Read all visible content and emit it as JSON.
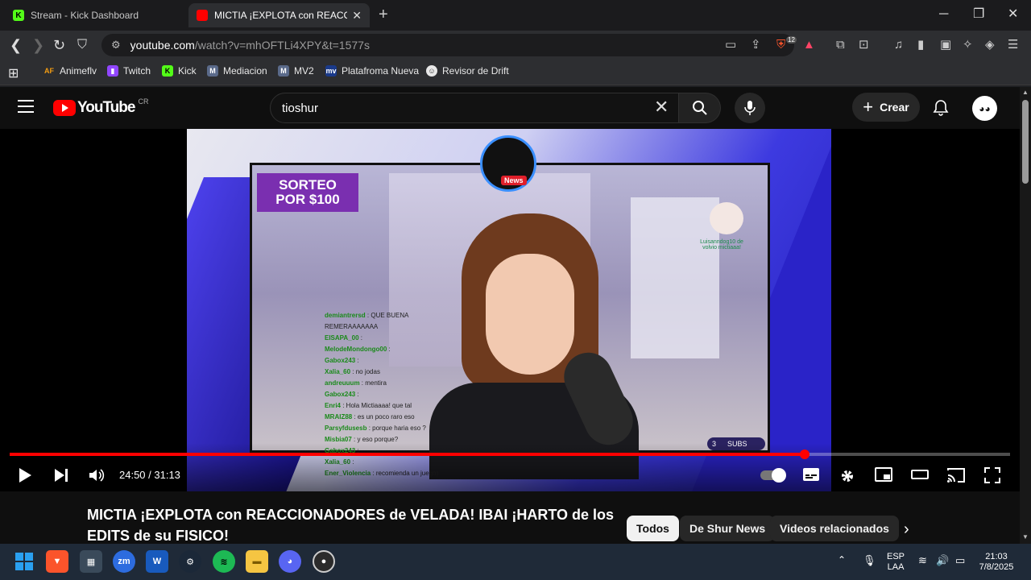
{
  "browser": {
    "tabs": [
      {
        "title": "Stream - Kick Dashboard",
        "favicon": "kick-icon",
        "active": false
      },
      {
        "title": "MICTIA ¡EXPLOTA con REACCIONADORES",
        "favicon": "youtube-icon",
        "active": true
      }
    ],
    "url_host": "youtube.com",
    "url_path": "/watch?v=mhOFTLi4XPY&t=1577s",
    "brave_badge": "12",
    "bookmarks": [
      {
        "label": "Animeflv",
        "icon": "AF"
      },
      {
        "label": "Twitch",
        "icon": "twitch-icon"
      },
      {
        "label": "Kick",
        "icon": "kick-icon"
      },
      {
        "label": "Mediacion",
        "icon": "M"
      },
      {
        "label": "MV2",
        "icon": "M"
      },
      {
        "label": "Platafroma Nueva",
        "icon": "mv"
      },
      {
        "label": "Revisor de Drift",
        "icon": "face-icon"
      }
    ]
  },
  "youtube": {
    "logo_text": "YouTube",
    "country": "CR",
    "search_value": "tioshur",
    "create_label": "Crear",
    "colors": {
      "brand": "#ff0000",
      "background": "#0f0f0f"
    }
  },
  "video": {
    "sorteo_line1": "SORTEO",
    "sorteo_line2": "POR $100",
    "news_badge": "News",
    "chat": [
      {
        "user": "demiantrersd",
        "msg": ": QUE BUENA REMERAAAAAAA"
      },
      {
        "user": "EISAPA_00",
        "msg": ":"
      },
      {
        "user": "MelodeMondongo00",
        "msg": ":"
      },
      {
        "user": "Gabox243",
        "msg": ":"
      },
      {
        "user": "Xalia_60",
        "msg": ": no jodas"
      },
      {
        "user": "andreuuum",
        "msg": ": mentira"
      },
      {
        "user": "Gabox243",
        "msg": ":"
      },
      {
        "user": "Enri4",
        "msg": ": Hola Mictiaaaa! que tal"
      },
      {
        "user": "MRAIZ88",
        "msg": ": es un poco raro eso"
      },
      {
        "user": "Parsyfdusesb",
        "msg": ": porque haria eso ?"
      },
      {
        "user": "Misbia07",
        "msg": ": y eso porque?"
      },
      {
        "user": "Gabox243",
        "msg": ":"
      },
      {
        "user": "Xalia_60",
        "msg": ":"
      },
      {
        "user": "Ener_Violencia",
        "msg": ": recomienda un juego)"
      }
    ],
    "alert_text": "Luisanndog10 de volvio mictiaaa!",
    "subs_count": "3",
    "subs_label": "SUBS",
    "time_display": "24:50 / 31:13",
    "progress_fraction": 0.7946,
    "title": "MICTIA ¡EXPLOTA con REACCIONADORES de VELADA! IBAI ¡HARTO de los EDITS de su FISICO!"
  },
  "chips": [
    "Todos",
    "De Shur News",
    "Videos relacionados"
  ],
  "taskbar": {
    "lang_line1": "ESP",
    "lang_line2": "LAA",
    "time": "21:03",
    "date": "7/8/2025"
  }
}
